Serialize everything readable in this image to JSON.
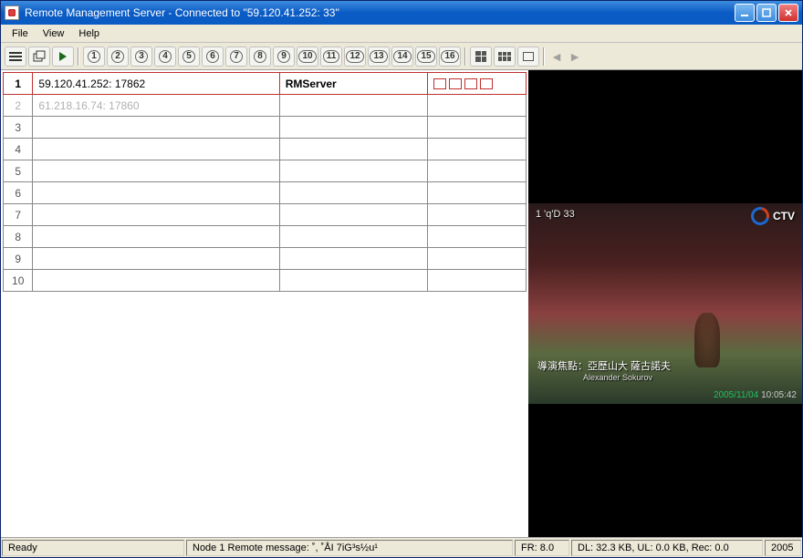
{
  "window": {
    "title": "Remote Management Server - Connected to \"59.120.41.252: 33\""
  },
  "menu": {
    "file": "File",
    "view": "View",
    "help": "Help"
  },
  "toolbar": {
    "channels": [
      "1",
      "2",
      "3",
      "4",
      "5",
      "6",
      "7",
      "8",
      "9",
      "10",
      "11",
      "12",
      "13",
      "14",
      "15",
      "16"
    ]
  },
  "table": {
    "rows": [
      {
        "num": "1",
        "addr": "59.120.41.252: 17862",
        "name": "RMServer",
        "selected": true,
        "boxes": 4
      },
      {
        "num": "2",
        "addr": "61.218.16.74: 17860",
        "name": "",
        "disabled": true
      },
      {
        "num": "3",
        "addr": "",
        "name": ""
      },
      {
        "num": "4",
        "addr": "",
        "name": ""
      },
      {
        "num": "5",
        "addr": "",
        "name": ""
      },
      {
        "num": "6",
        "addr": "",
        "name": ""
      },
      {
        "num": "7",
        "addr": "",
        "name": ""
      },
      {
        "num": "8",
        "addr": "",
        "name": ""
      },
      {
        "num": "9",
        "addr": "",
        "name": ""
      },
      {
        "num": "10",
        "addr": "",
        "name": ""
      }
    ]
  },
  "video": {
    "top_left": "1 'q'D 33",
    "logo_text": "CTV",
    "subtitle_cjk": "導演焦點：亞歷山大  薩古諾夫",
    "subtitle_eng": "Alexander Sokurov",
    "timestamp_date": "2005/11/04",
    "timestamp_time": "10:05:42"
  },
  "status": {
    "ready": "Ready",
    "message": "Node 1 Remote message: ˚, ˚ÅI 7iG³s½u¹",
    "fr": "FR: 8.0",
    "dl": "DL: 32.3 KB, UL: 0.0 KB, Rec: 0.0",
    "year": "2005"
  }
}
